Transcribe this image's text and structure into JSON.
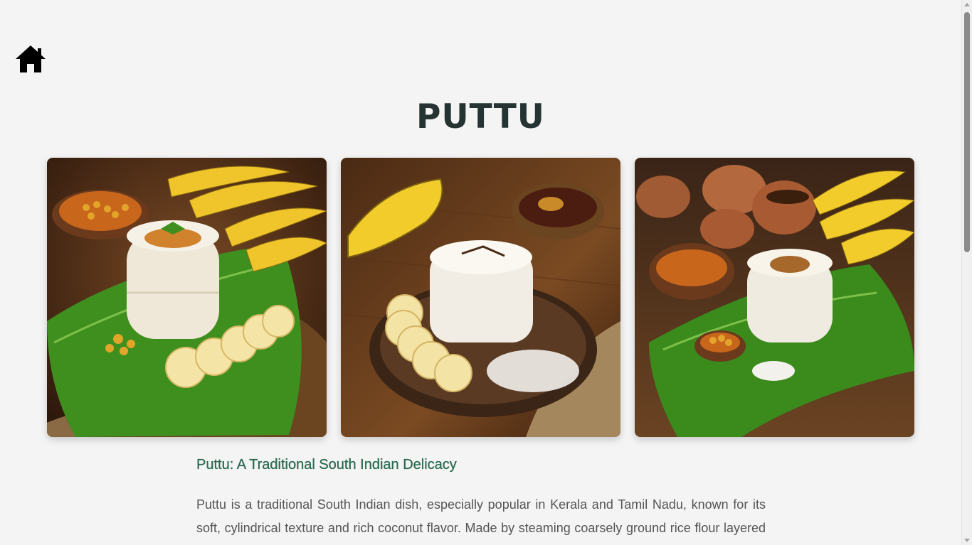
{
  "nav": {
    "home_icon": "home-icon"
  },
  "page": {
    "title": "PUTTU"
  },
  "gallery": {
    "images": [
      {
        "name": "puttu-photo-1"
      },
      {
        "name": "puttu-photo-2"
      },
      {
        "name": "puttu-photo-3"
      }
    ]
  },
  "article": {
    "heading": "Puttu: A Traditional South Indian Delicacy",
    "paragraph": "Puttu is a traditional South Indian dish, especially popular in Kerala and Tamil Nadu, known for its soft, cylindrical texture and rich coconut flavor. Made by steaming coarsely ground rice flour layered with fresh grated coconut, Puttu is a wholesome and nutritious meal. It is typically enjoyed with rip"
  },
  "colors": {
    "background": "#f4f4f4",
    "title": "#253333",
    "heading": "#2b6b50",
    "body_text": "#555555"
  }
}
